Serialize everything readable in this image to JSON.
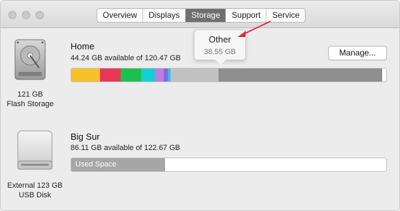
{
  "tabs": [
    {
      "label": "Overview",
      "active": false
    },
    {
      "label": "Displays",
      "active": false
    },
    {
      "label": "Storage",
      "active": true
    },
    {
      "label": "Support",
      "active": false
    },
    {
      "label": "Service",
      "active": false
    }
  ],
  "volumes": [
    {
      "name": "Home",
      "available": "44.24 GB available of 120.47 GB",
      "caption_line1": "121 GB",
      "caption_line2": "Flash Storage",
      "icon": "hard-drive-icon",
      "segments_colors": [
        "#f7c229",
        "#e73657",
        "#1fbf4f",
        "#12d0d6",
        "#c27be1",
        "#7e6bd9",
        "#3fb8f3",
        "#c1c1c1",
        "#8f8f8f"
      ],
      "segments_fractions": [
        0.091,
        0.065,
        0.065,
        0.045,
        0.028,
        0.012,
        0.009,
        0.152,
        0.52
      ]
    },
    {
      "name": "Big Sur",
      "available": "86.11 GB available of 122.67 GB",
      "caption_line1": "External 123 GB",
      "caption_line2": "USB Disk",
      "icon": "external-disk-icon",
      "used_label": "Used Space",
      "used_fraction": 0.298,
      "used_color": "#a6a6a6"
    }
  ],
  "manage_label": "Manage...",
  "tooltip": {
    "title": "Other",
    "value": "38.55 GB"
  },
  "annotation_color": "#e3262f"
}
